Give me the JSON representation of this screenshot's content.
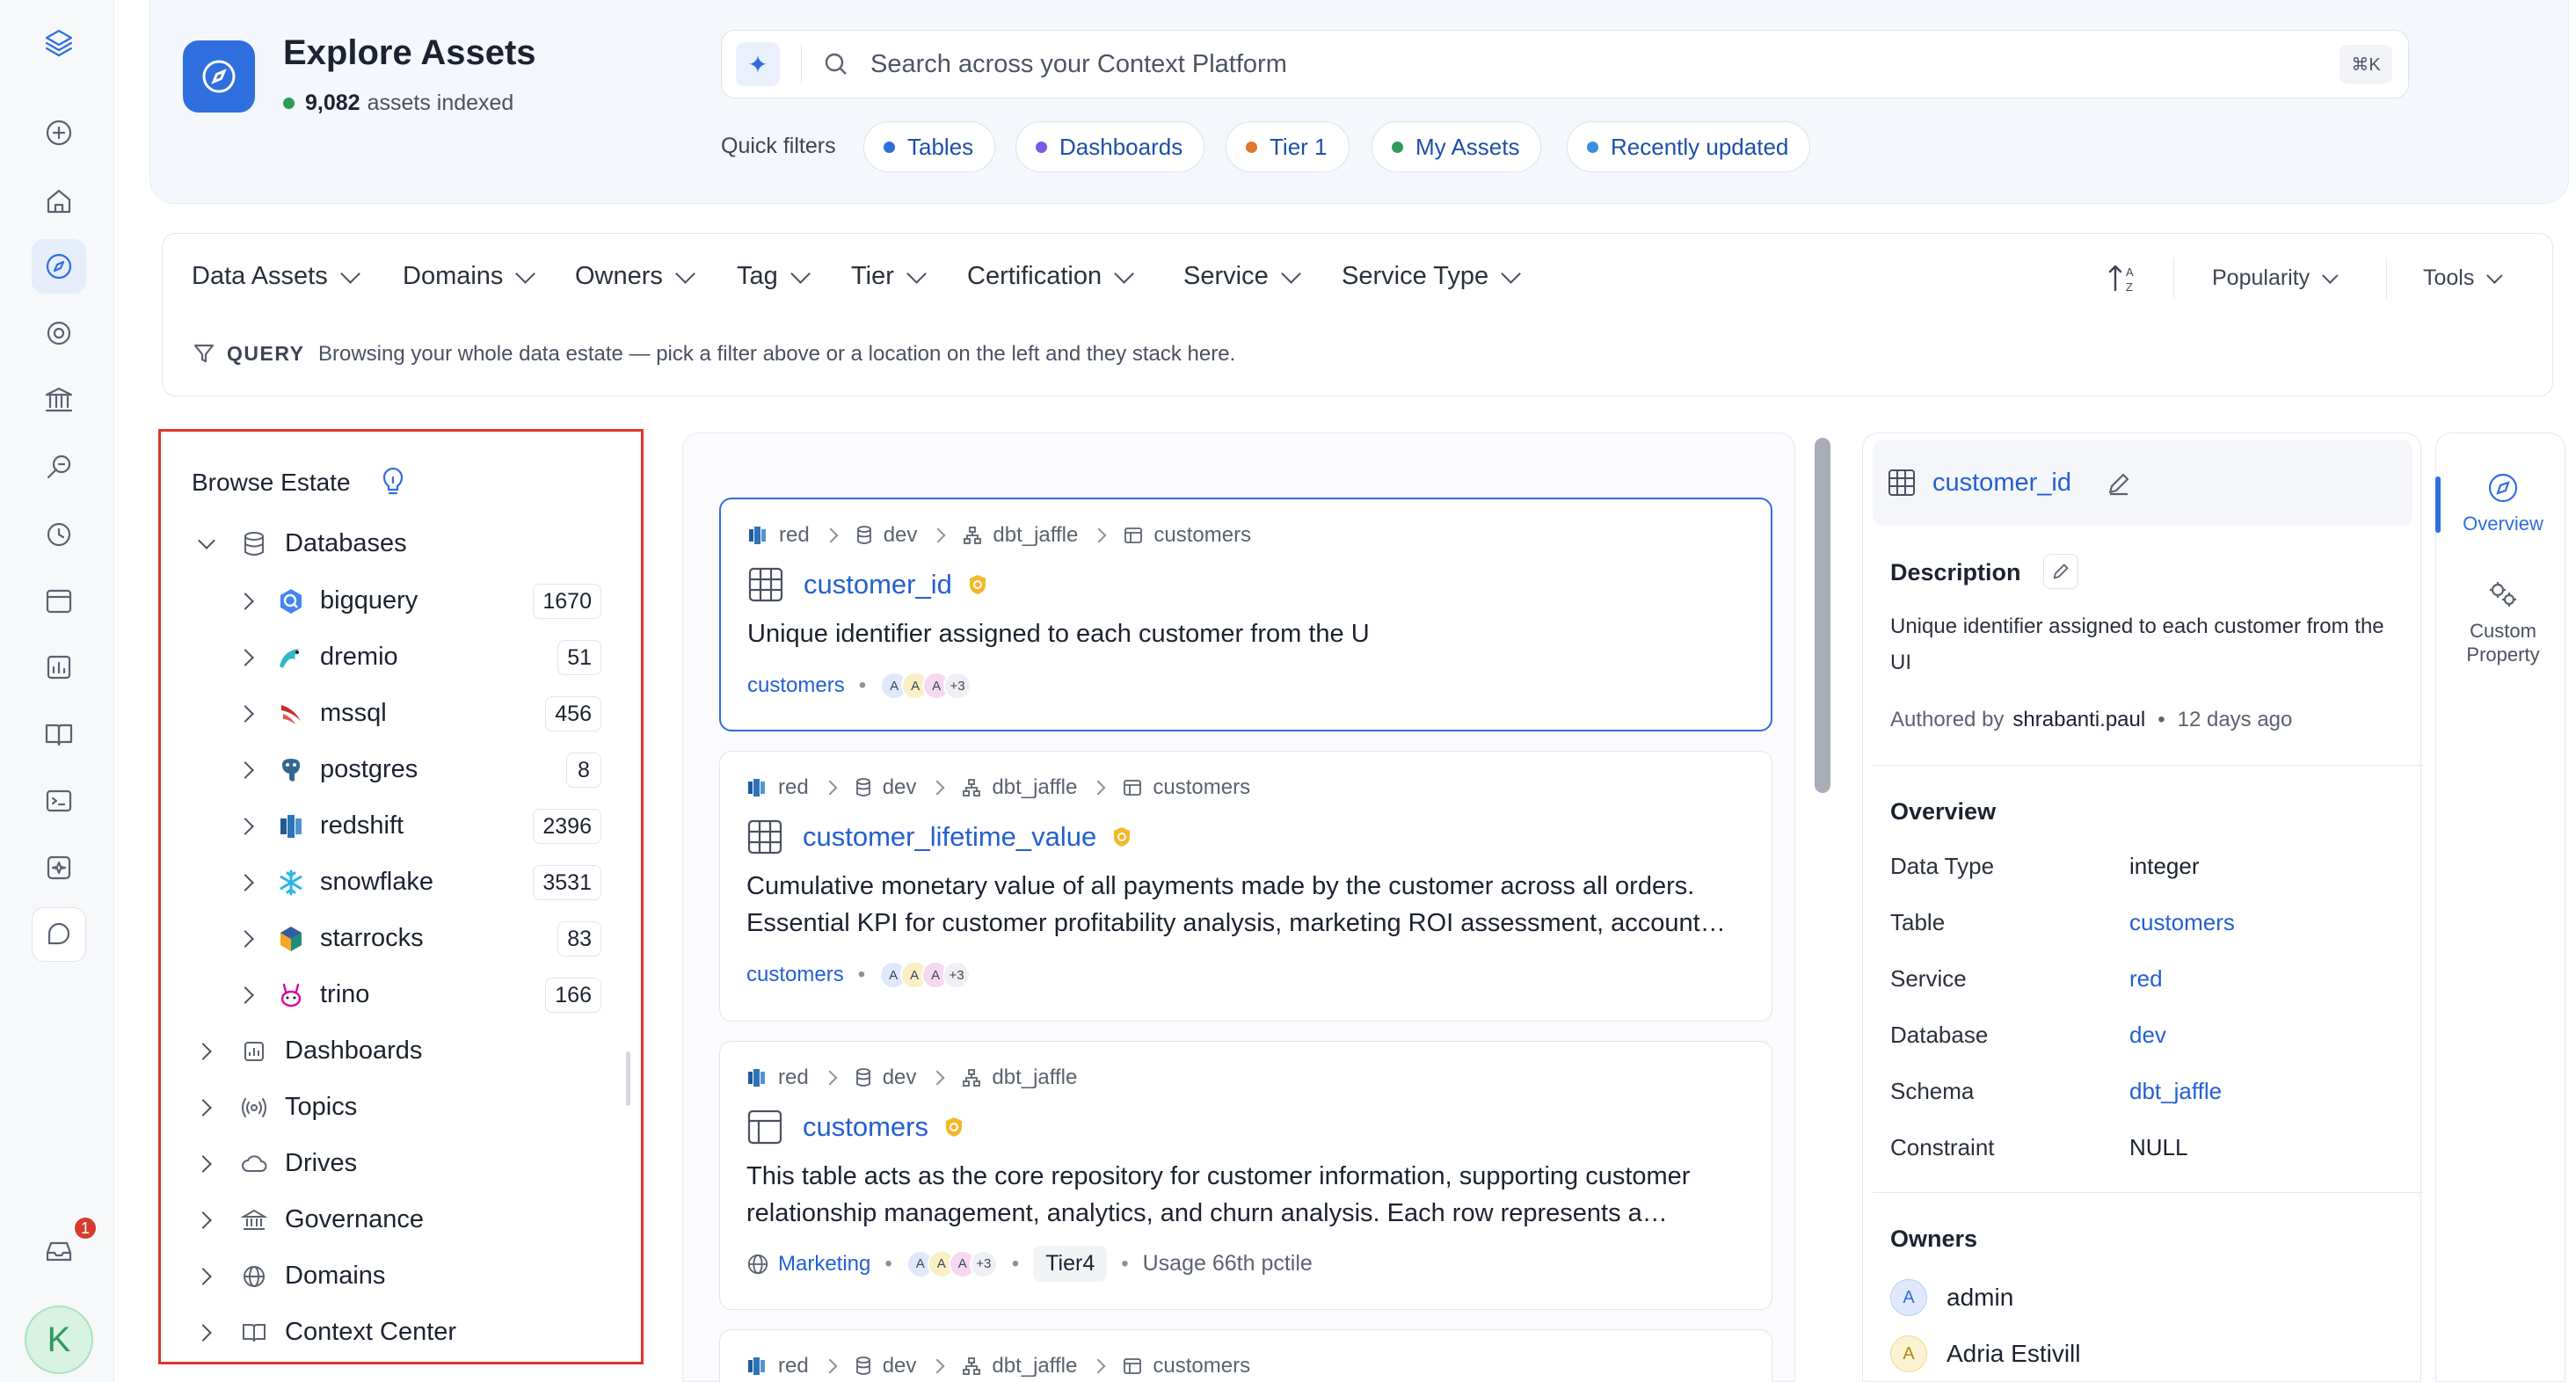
{
  "header": {
    "title": "Explore Assets",
    "indexed_count": "9,082",
    "indexed_suffix": "assets indexed",
    "search_placeholder": "Search across your Context Platform",
    "shortcut": "⌘K",
    "quick_filters_label": "Quick filters",
    "quick_filters": [
      {
        "label": "Tables",
        "color": "#2f6fdf"
      },
      {
        "label": "Dashboards",
        "color": "#7b5be3"
      },
      {
        "label": "Tier 1",
        "color": "#e0782c"
      },
      {
        "label": "My Assets",
        "color": "#2e9b5b"
      },
      {
        "label": "Recently updated",
        "color": "#3b8fe0"
      }
    ]
  },
  "filters": {
    "facets": [
      "Data Assets",
      "Domains",
      "Owners",
      "Tag",
      "Tier",
      "Certification",
      "Service",
      "Service Type"
    ],
    "sort_icon": "sort-alpha-icon",
    "sort_label": "Popularity",
    "tools_label": "Tools",
    "query_label": "QUERY",
    "query_text": "Browsing your whole data estate — pick a filter above or a location on the left and they stack here."
  },
  "browse": {
    "title": "Browse Estate",
    "root": "Databases",
    "services": [
      {
        "name": "bigquery",
        "count": "1670",
        "icon": "bigquery-icon"
      },
      {
        "name": "dremio",
        "count": "51",
        "icon": "dremio-icon"
      },
      {
        "name": "mssql",
        "count": "456",
        "icon": "mssql-icon"
      },
      {
        "name": "postgres",
        "count": "8",
        "icon": "postgres-icon"
      },
      {
        "name": "redshift",
        "count": "2396",
        "icon": "redshift-icon"
      },
      {
        "name": "snowflake",
        "count": "3531",
        "icon": "snowflake-icon"
      },
      {
        "name": "starrocks",
        "count": "83",
        "icon": "starrocks-icon"
      },
      {
        "name": "trino",
        "count": "166",
        "icon": "trino-icon"
      }
    ],
    "sections": [
      "Dashboards",
      "Topics",
      "Drives",
      "Governance",
      "Domains",
      "Context Center"
    ]
  },
  "results": [
    {
      "crumbs": [
        "red",
        "dev",
        "dbt_jaffle",
        "customers"
      ],
      "title": "customer_id",
      "description": "Unique identifier assigned to each customer from the U",
      "parent": "customers",
      "avatars": [
        "A",
        "A",
        "A"
      ],
      "more": "+3"
    },
    {
      "crumbs": [
        "red",
        "dev",
        "dbt_jaffle",
        "customers"
      ],
      "title": "customer_lifetime_value",
      "description": "Cumulative monetary value of all payments made by the customer across all orders. Essential KPI for customer profitability analysis, marketing ROI assessment, account…",
      "parent": "customers",
      "avatars": [
        "A",
        "A",
        "A"
      ],
      "more": "+3"
    },
    {
      "crumbs": [
        "red",
        "dev",
        "dbt_jaffle"
      ],
      "title": "customers",
      "description": "This table acts as the core repository for customer information, supporting customer relationship management, analytics, and churn analysis. Each row represents a…",
      "domain": "Marketing",
      "avatars": [
        "A",
        "A",
        "A"
      ],
      "more": "+3",
      "tier": "Tier4",
      "usage": "Usage 66th pctile"
    },
    {
      "crumbs": [
        "red",
        "dev",
        "dbt_jaffle",
        "customers"
      ]
    }
  ],
  "detail": {
    "title": "customer_id",
    "description_heading": "Description",
    "description": "Unique identifier assigned to each customer from the UI",
    "authored_by_label": "Authored by",
    "author": "shrabanti.paul",
    "authored_when": "12 days ago",
    "overview_heading": "Overview",
    "overview": [
      {
        "key": "Data Type",
        "value": "integer",
        "link": false
      },
      {
        "key": "Table",
        "value": "customers",
        "link": true
      },
      {
        "key": "Service",
        "value": "red",
        "link": true
      },
      {
        "key": "Database",
        "value": "dev",
        "link": true
      },
      {
        "key": "Schema",
        "value": "dbt_jaffle",
        "link": true
      },
      {
        "key": "Constraint",
        "value": "NULL",
        "link": false
      }
    ],
    "owners_heading": "Owners",
    "owners": [
      {
        "initial": "A",
        "name": "admin"
      },
      {
        "initial": "A",
        "name": "Adria Estivill"
      }
    ]
  },
  "side_tabs": [
    {
      "label": "Overview",
      "icon": "compass-icon"
    },
    {
      "label": "Custom Property",
      "icon": "properties-icon"
    }
  ],
  "user": {
    "initial": "K",
    "notifications": "1"
  }
}
